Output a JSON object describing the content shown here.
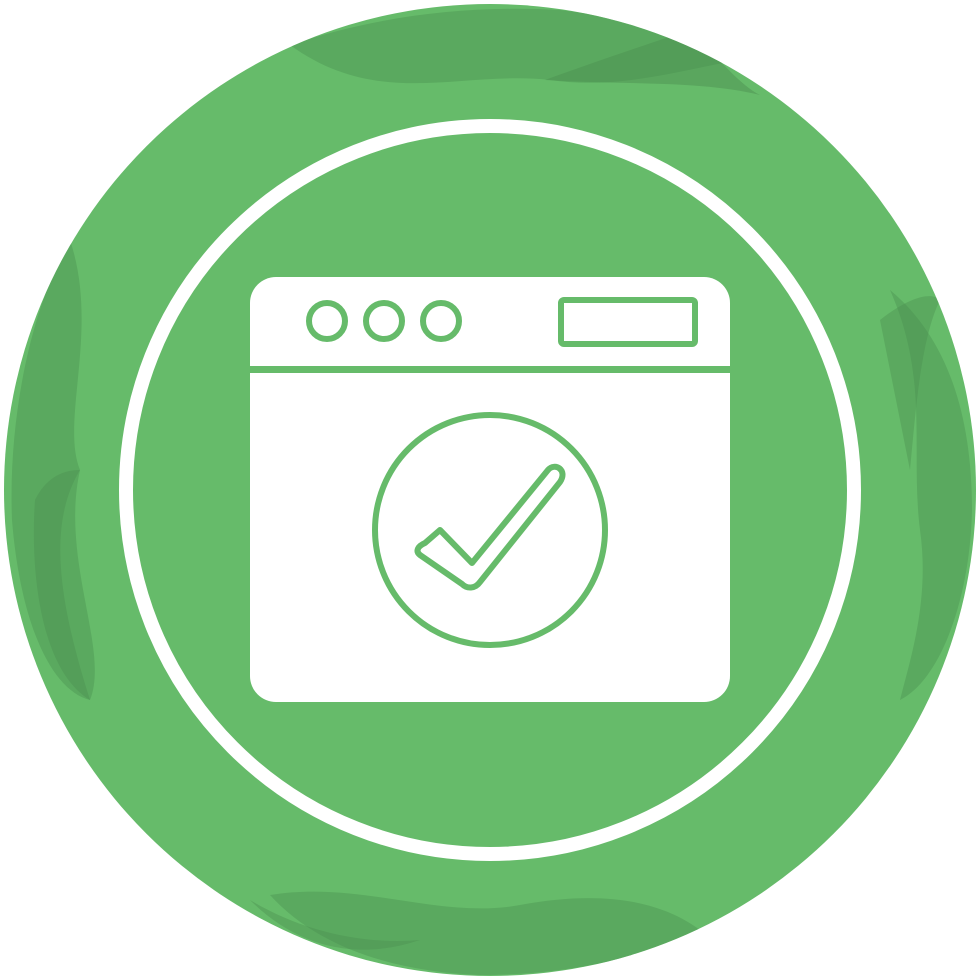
{
  "icon": {
    "name": "browser-verified-icon",
    "colors": {
      "primary_green": "#66bb6a",
      "shadow_green": "#519a55",
      "white": "#ffffff",
      "background": "#ffffff"
    }
  }
}
